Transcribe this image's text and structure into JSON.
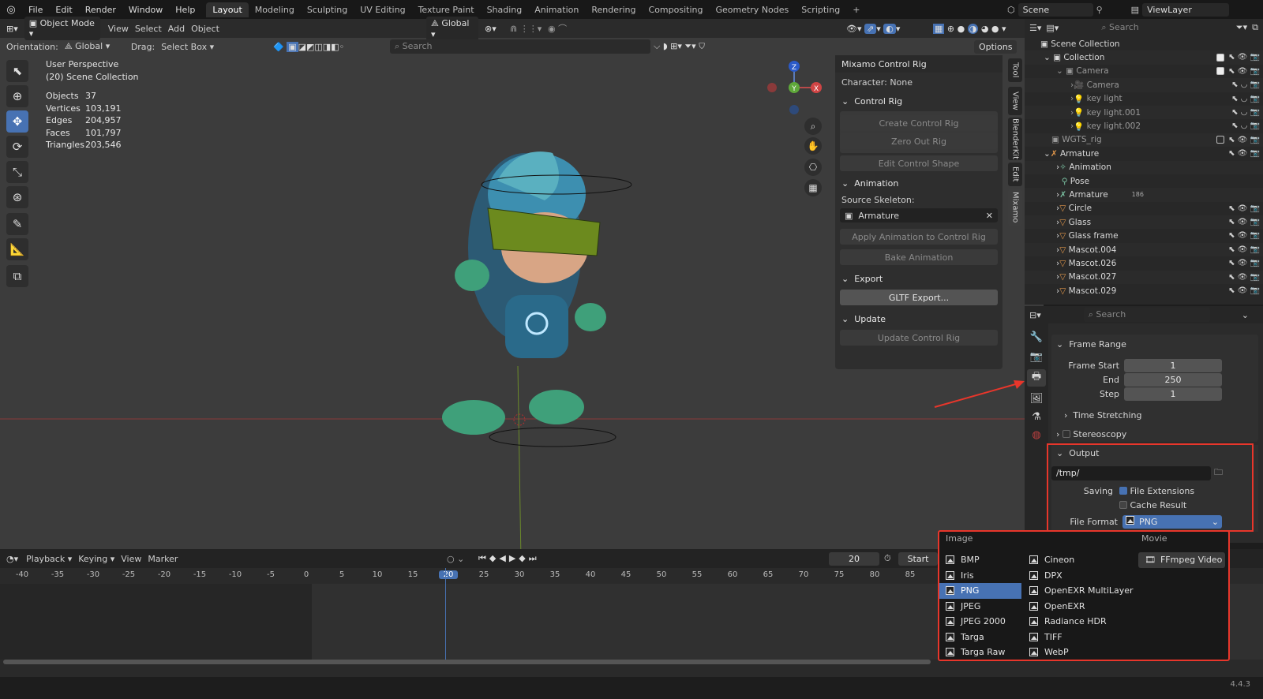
{
  "topbar": {
    "menus": [
      "File",
      "Edit",
      "Render",
      "Window",
      "Help"
    ],
    "tabs": [
      "Layout",
      "Modeling",
      "Sculpting",
      "UV Editing",
      "Texture Paint",
      "Shading",
      "Animation",
      "Rendering",
      "Compositing",
      "Geometry Nodes",
      "Scripting"
    ],
    "add_tab": "+",
    "scene": "Scene",
    "view_layer": "ViewLayer"
  },
  "viewport": {
    "mode": "Object Mode",
    "menus": [
      "View",
      "Select",
      "Add",
      "Object"
    ],
    "transform": "Global",
    "orientation_label": "Orientation:",
    "orientation": "Global",
    "drag_label": "Drag:",
    "drag": "Select Box",
    "search_placeholder": "Search",
    "options": "Options",
    "perspective": "User Perspective",
    "collection": "(20) Scene Collection",
    "stats": [
      {
        "k": "Objects",
        "v": "37"
      },
      {
        "k": "Vertices",
        "v": "103,191"
      },
      {
        "k": "Edges",
        "v": "204,957"
      },
      {
        "k": "Faces",
        "v": "101,797"
      },
      {
        "k": "Triangles",
        "v": "203,546"
      }
    ],
    "gizmo": {
      "z": "Z",
      "x": "X",
      "y": "Y"
    }
  },
  "npanel": {
    "title": "Mixamo Control Rig",
    "character": "Character: None",
    "control_rig": "Control Rig",
    "create": "Create Control Rig",
    "zero_out": "Zero Out Rig",
    "edit_shape": "Edit Control Shape",
    "animation": "Animation",
    "source_skeleton": "Source Skeleton:",
    "armature": "Armature",
    "apply": "Apply Animation to Control Rig",
    "bake": "Bake Animation",
    "export": "Export",
    "gltf": "GLTF Export...",
    "update": "Update",
    "update_rig": "Update Control Rig",
    "tabs": [
      "Tool",
      "View",
      "BlenderKit",
      "Edit",
      "Mixamo"
    ]
  },
  "outliner": {
    "search_placeholder": "Search",
    "rows": [
      {
        "name": "Scene Collection",
        "indent": 0
      },
      {
        "name": "Collection",
        "indent": 1
      },
      {
        "name": "Camera",
        "indent": 2
      },
      {
        "name": "Camera",
        "indent": 3
      },
      {
        "name": "key light",
        "indent": 3
      },
      {
        "name": "key light.001",
        "indent": 3
      },
      {
        "name": "key light.002",
        "indent": 3
      },
      {
        "name": "WGTS_rig",
        "indent": 1
      },
      {
        "name": "Armature",
        "indent": 1
      },
      {
        "name": "Animation",
        "indent": 2
      },
      {
        "name": "Pose",
        "indent": 2
      },
      {
        "name": "Armature",
        "indent": 2
      },
      {
        "name": "Circle",
        "indent": 2
      },
      {
        "name": "Glass",
        "indent": 2
      },
      {
        "name": "Glass frame",
        "indent": 2
      },
      {
        "name": "Mascot.004",
        "indent": 2
      },
      {
        "name": "Mascot.026",
        "indent": 2
      },
      {
        "name": "Mascot.027",
        "indent": 2
      },
      {
        "name": "Mascot.029",
        "indent": 2
      }
    ],
    "bone_count": "186"
  },
  "props": {
    "search_placeholder": "Search",
    "frame_range": "Frame Range",
    "frame_start_label": "Frame Start",
    "frame_start": "1",
    "end_label": "End",
    "end": "250",
    "step_label": "Step",
    "step": "1",
    "time_stretching": "Time Stretching",
    "stereoscopy": "Stereoscopy",
    "output": "Output",
    "path": "/tmp/",
    "saving_label": "Saving",
    "file_extensions": "File Extensions",
    "cache_result": "Cache Result",
    "file_format_label": "File Format",
    "file_format": "PNG"
  },
  "timeline": {
    "menus": [
      "Playback",
      "Keying",
      "View",
      "Marker"
    ],
    "current_frame": "20",
    "start_label": "Start",
    "ticks": [
      "-40",
      "-35",
      "-30",
      "-25",
      "-20",
      "-15",
      "-10",
      "-5",
      "0",
      "5",
      "10",
      "15",
      "20",
      "25",
      "30",
      "35",
      "40",
      "45",
      "50",
      "55",
      "60",
      "65",
      "70",
      "75",
      "80",
      "85"
    ],
    "version": "4.4.3"
  },
  "dropdown": {
    "image_header": "Image",
    "movie_header": "Movie",
    "col1": [
      "BMP",
      "Iris",
      "PNG",
      "JPEG",
      "JPEG 2000",
      "Targa",
      "Targa Raw"
    ],
    "col2": [
      "Cineon",
      "DPX",
      "OpenEXR MultiLayer",
      "OpenEXR",
      "Radiance HDR",
      "TIFF",
      "WebP"
    ],
    "movie": "FFmpeg Video",
    "selected": "PNG"
  },
  "colors": {
    "accent": "#4772b3",
    "highlight": "#e8362b"
  }
}
